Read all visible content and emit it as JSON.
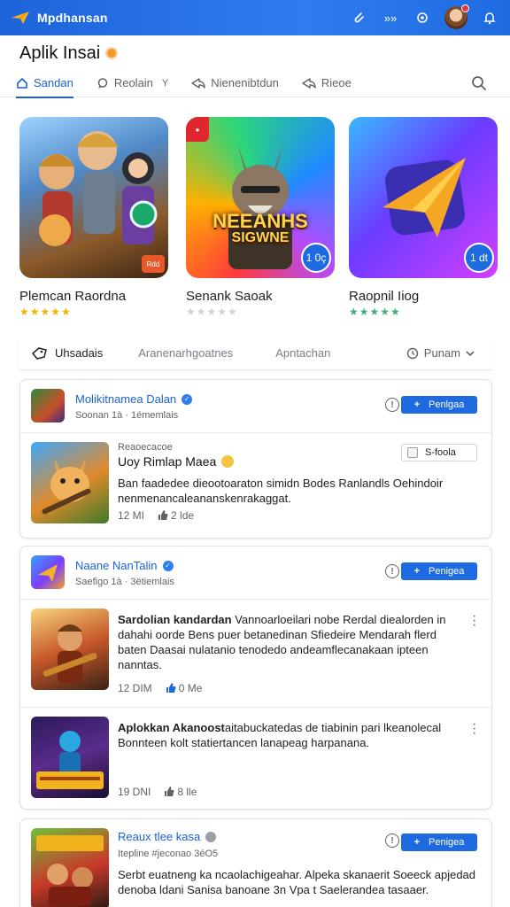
{
  "appbar": {
    "brand": "Mpdhansan",
    "icons": [
      "logo-icon",
      "attach-icon",
      "broadcast-icon",
      "settings-gear-icon",
      "avatar",
      "bell-icon"
    ],
    "accent": "#1e63d9",
    "icon_text": "»»"
  },
  "page": {
    "title": "Aplik Insai"
  },
  "tabs": [
    {
      "label": "Sandan",
      "active": true
    },
    {
      "label": "Reolain",
      "has_caret": true,
      "caret": "Y"
    },
    {
      "label": "Nienenibtdun"
    },
    {
      "label": "Rieoe"
    }
  ],
  "featured": [
    {
      "name": "Plemcan Raordna",
      "stars": "★★★★★",
      "badge": "Rdd"
    },
    {
      "name": "Senank Saoak",
      "stars": "★★★★★",
      "art_line1": "NEEANHS",
      "art_line2": "SIGWNE",
      "badge": "1 0ç"
    },
    {
      "name": "Raopnil Iiog",
      "stars": "★★★★★",
      "badge": "1 dt"
    }
  ],
  "filterbar": {
    "item1": "Uhsadais",
    "item2": "Aranenarhgoatnes",
    "item3": "Apntachan",
    "sort_label": "Punam"
  },
  "cards": [
    {
      "name": "Molikitnamea Dalan",
      "meta": "Soonan 1à · 1émemlais",
      "follow_label": "Penlgaa",
      "posts": [
        {
          "tagline": "Reaoecacoe",
          "title": "Uoy Rimlap Maea",
          "check_label": "S-foola",
          "text": "Ban faadedee dieootoaraton simidn Bodes Ranlandls Oehindoir nenmenancaleananskenrakaggat.",
          "views": "12 MI",
          "likes": "2 lde"
        }
      ]
    },
    {
      "name": "Naane NanTalin",
      "meta": "Saefigo 1à · 3ëtiemlais",
      "follow_label": "Penigea",
      "posts": [
        {
          "lead": "Sardolian kandardan",
          "text": " Vannoarloeilari nobe Rerdal diealorden in dahahi oorde Bens puer betanedinan Sfiedeire Mendarah flerd baten Daasai nulatanio tenodedo andeamflecanakaan ipteen nanntas.",
          "views": "12 DIM",
          "likes": "0 Me"
        },
        {
          "lead": "Aplokkan Akanoost",
          "text": "aitabuckatedas de tiabinin pari lkeanolecal Bonnteen kolt statiertancen lanapeag harpanana.",
          "views": "19 DNI",
          "likes": "8 lle"
        }
      ]
    },
    {
      "name": "Reaux tlee kasa",
      "meta": "Itepline #jeconao 3éO5",
      "follow_label": "Penigea",
      "posts": [
        {
          "text": "Serbt euatneng ka ncaolachigeahar. Alpeka skanaerit Soeeck apjedad denoba ldani Sanisa banoane 3n Vpa t Saelerandea tasaaer."
        }
      ]
    }
  ]
}
